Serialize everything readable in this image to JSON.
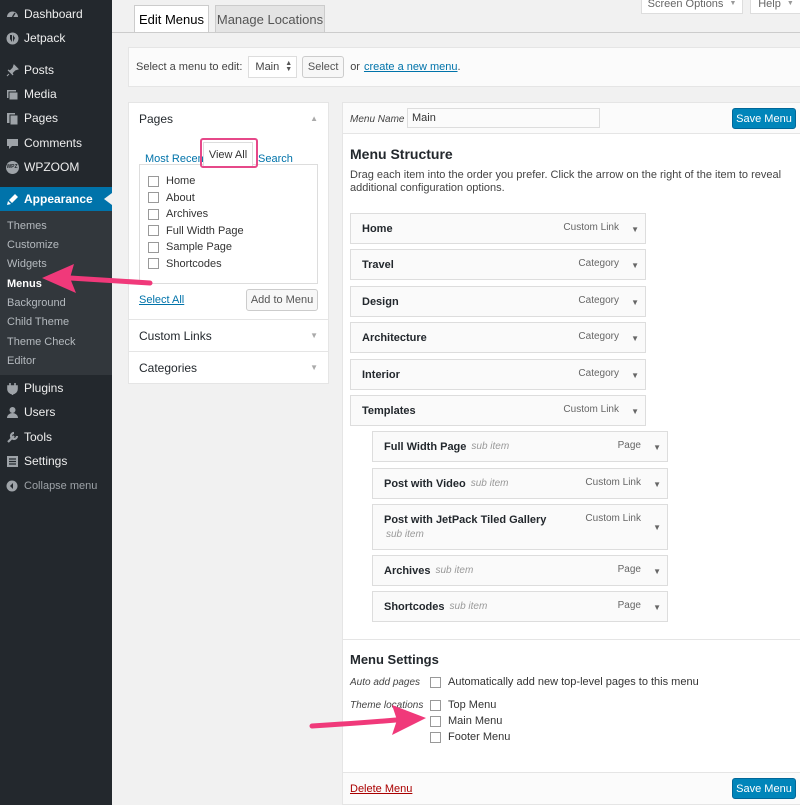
{
  "colors": {
    "accent": "#0073aa",
    "annotation": "#f0397a",
    "sidebar": "#23282d"
  },
  "sidebar": {
    "items": [
      {
        "label": "Dashboard",
        "icon": "dashboard-icon"
      },
      {
        "label": "Jetpack",
        "icon": "jetpack-icon"
      },
      {
        "label": "Posts",
        "icon": "pin-icon"
      },
      {
        "label": "Media",
        "icon": "media-icon"
      },
      {
        "label": "Pages",
        "icon": "pages-icon"
      },
      {
        "label": "Comments",
        "icon": "comments-icon"
      },
      {
        "label": "WPZOOM",
        "icon": "wpzoom-icon",
        "badge": "WPZ"
      },
      {
        "label": "Appearance",
        "icon": "appearance-icon"
      }
    ],
    "submenu": [
      "Themes",
      "Customize",
      "Widgets",
      "Menus",
      "Background",
      "Child Theme",
      "Theme Check",
      "Editor"
    ],
    "lower": [
      {
        "label": "Plugins",
        "icon": "plugins-icon"
      },
      {
        "label": "Users",
        "icon": "users-icon"
      },
      {
        "label": "Tools",
        "icon": "tools-icon"
      },
      {
        "label": "Settings",
        "icon": "settings-icon"
      }
    ],
    "collapse": "Collapse menu"
  },
  "top": {
    "screen_options": "Screen Options",
    "help": "Help"
  },
  "tabs": {
    "edit": "Edit Menus",
    "manage": "Manage Locations"
  },
  "manage": {
    "label": "Select a menu to edit:",
    "selected": "Main",
    "select_btn": "Select",
    "or": "or",
    "create_link": "create a new menu",
    "period": "."
  },
  "left": {
    "pages_title": "Pages",
    "tab_recent": "Most Recent",
    "tab_all": "View All",
    "tab_search": "Search",
    "pages": [
      "Home",
      "About",
      "Archives",
      "Full Width Page",
      "Sample Page",
      "Shortcodes"
    ],
    "select_all": "Select All",
    "add_btn": "Add to Menu",
    "custom_links": "Custom Links",
    "categories": "Categories"
  },
  "right": {
    "menu_name_label": "Menu Name",
    "menu_name_value": "Main",
    "save": "Save Menu",
    "structure_title": "Menu Structure",
    "structure_desc": "Drag each item into the order you prefer. Click the arrow on the right of the item to reveal additional configuration options.",
    "items": [
      {
        "title": "Home",
        "type": "Custom Link"
      },
      {
        "title": "Travel",
        "type": "Category"
      },
      {
        "title": "Design",
        "type": "Category"
      },
      {
        "title": "Architecture",
        "type": "Category"
      },
      {
        "title": "Interior",
        "type": "Category"
      },
      {
        "title": "Templates",
        "type": "Custom Link"
      }
    ],
    "subitems": [
      {
        "title": "Full Width Page",
        "sub": "sub item",
        "type": "Page"
      },
      {
        "title": "Post with Video",
        "sub": "sub item",
        "type": "Custom Link"
      },
      {
        "title": "Post with JetPack Tiled Gallery",
        "sub": "sub item",
        "type": "Custom Link"
      },
      {
        "title": "Archives",
        "sub": "sub item",
        "type": "Page"
      },
      {
        "title": "Shortcodes",
        "sub": "sub item",
        "type": "Page"
      }
    ],
    "settings_title": "Menu Settings",
    "auto_add_label": "Auto add pages",
    "auto_add_text": "Automatically add new top-level pages to this menu",
    "locations_label": "Theme locations",
    "locations": [
      "Top Menu",
      "Main Menu",
      "Footer Menu"
    ],
    "delete": "Delete Menu"
  }
}
